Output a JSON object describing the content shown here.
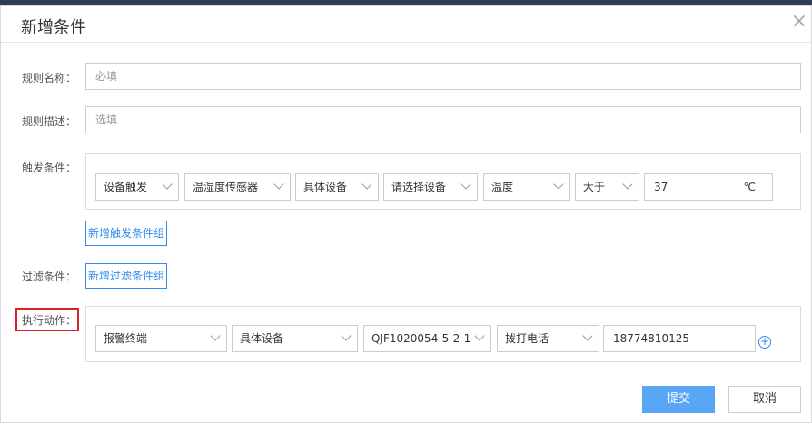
{
  "dialog": {
    "title": "新增条件",
    "close_glyph": "×"
  },
  "form": {
    "rule_name": {
      "label": "规则名称：",
      "placeholder": "必填",
      "value": ""
    },
    "rule_desc": {
      "label": "规则描述：",
      "placeholder": "选填",
      "value": ""
    },
    "trigger": {
      "label": "触发条件：",
      "selects": [
        "设备触发",
        "温湿度传感器",
        "具体设备",
        "请选择设备",
        "温度",
        "大于"
      ],
      "value": "37",
      "unit": "℃",
      "add_group_label": "新增触发条件组"
    },
    "filter": {
      "label": "过滤条件：",
      "add_group_label": "新增过滤条件组"
    },
    "action": {
      "label": "执行动作：",
      "selects": [
        "报警终端",
        "具体设备",
        "QJF1020054-5-2-1",
        "拨打电话"
      ],
      "value": "18774810125",
      "add_icon": "plus-circle-icon"
    }
  },
  "buttons": {
    "submit": "提交",
    "cancel": "取消"
  },
  "colors": {
    "primary": "#5aa6f6",
    "link": "#2d8cf0",
    "highlight_border": "#d9222a"
  }
}
